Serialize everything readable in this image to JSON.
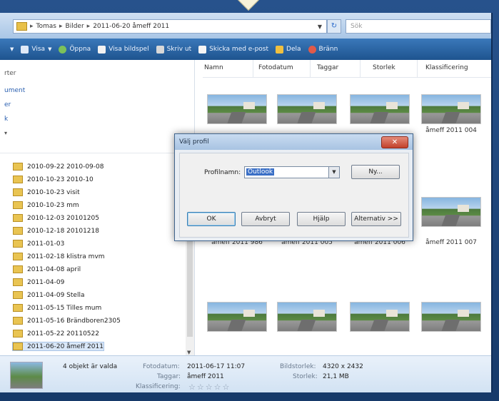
{
  "address_bar": {
    "crumbs": [
      "Tomas",
      "Bilder",
      "2011-06-20 åmeff 2011"
    ],
    "search_placeholder": "Sök"
  },
  "toolbar": {
    "items": [
      "Visa",
      "Öppna",
      "Visa bildspel",
      "Skriv ut",
      "Skicka med e-post",
      "Dela",
      "Bränn"
    ]
  },
  "nav": {
    "favorites": [
      "rter",
      "ument",
      "er",
      "k"
    ],
    "folders": [
      "2010-09-22 2010-09-08",
      "2010-10-23 2010-10",
      "2010-10-23 visit",
      "2010-10-23 mm",
      "2010-12-03 20101205",
      "2010-12-18 20101218",
      "2011-01-03",
      "2011-02-18 klistra mvm",
      "2011-04-08 april",
      "2011-04-09",
      "2011-04-09 Stella",
      "2011-05-15 Tilles mum",
      "2011-05-16 Brändboren2305",
      "2011-05-22 20110522",
      "2011-06-20 åmeff 2011"
    ]
  },
  "columns": [
    "Namn",
    "Fotodatum",
    "Taggar",
    "Storlek",
    "Klassificering"
  ],
  "thumbnails": {
    "row1_caption": "åmeff 2011 004",
    "row2_captions": [
      "åmeff 2011 986",
      "åmeff 2011 005",
      "åmeff 2011 006",
      "åmeff 2011 007"
    ]
  },
  "details": {
    "selected_count": "4 objekt är valda",
    "fotodatum_label": "Fotodatum:",
    "fotodatum_value": "2011-06-17 11:07",
    "taggar_label": "Taggar:",
    "taggar_value": "åmeff 2011",
    "klass_label": "Klassificering:",
    "bildstorlek_label": "Bildstorlek:",
    "bildstorlek_value": "4320 x 2432",
    "storlek_label": "Storlek:",
    "storlek_value": "21,1 MB",
    "stars": "☆☆☆☆☆"
  },
  "dialog": {
    "title": "Välj profil",
    "close": "✕",
    "profile_label": "Profilnamn:",
    "profile_value": "Outlook",
    "new_button": "Ny...",
    "ok": "OK",
    "cancel": "Avbryt",
    "help": "Hjälp",
    "options": "Alternativ >>"
  },
  "colors": {
    "toolbar": "#2a64a4",
    "link": "#2a5fb0",
    "close_button": "#c2412b"
  }
}
